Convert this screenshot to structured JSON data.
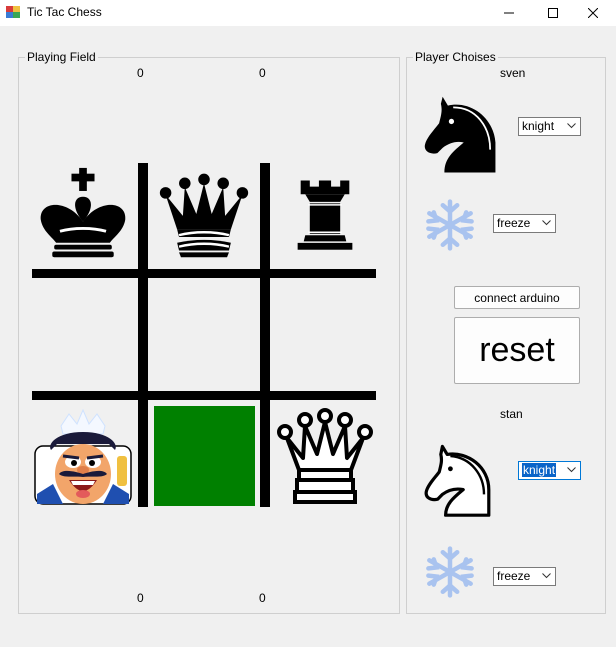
{
  "window": {
    "title": "Tic Tac Chess",
    "icons": {
      "app": "app-icon",
      "minimize": "minimize-icon",
      "maximize": "maximize-icon",
      "close": "close-icon"
    }
  },
  "playing_field": {
    "label": "Playing Field",
    "scores_top": [
      "0",
      "0"
    ],
    "scores_bottom": [
      "0",
      "0"
    ],
    "cells": [
      {
        "content": "black-king-icon",
        "highlight": false
      },
      {
        "content": "black-queen-icon",
        "highlight": false
      },
      {
        "content": "black-rook-icon",
        "highlight": false
      },
      {
        "content": "empty",
        "highlight": false
      },
      {
        "content": "empty",
        "highlight": false
      },
      {
        "content": "empty",
        "highlight": false
      },
      {
        "content": "cartoon-king-emote",
        "highlight": false
      },
      {
        "content": "empty",
        "highlight": true,
        "color": "#008000"
      },
      {
        "content": "white-queen-icon",
        "highlight": false
      }
    ]
  },
  "player_choices": {
    "label": "Player Choises",
    "player1": {
      "name": "sven",
      "piece_icon": "black-knight-icon",
      "piece_select": "knight",
      "power_icon": "snowflake-icon",
      "power_select": "freeze"
    },
    "player2": {
      "name": "stan",
      "piece_icon": "white-knight-icon",
      "piece_select": "knight",
      "power_icon": "snowflake-icon",
      "power_select": "freeze"
    },
    "connect_button": "connect arduino",
    "reset_button": "reset"
  },
  "colors": {
    "highlight": "#008000",
    "selection": "#0a64c8",
    "snowflake": "#a9c3ef"
  }
}
